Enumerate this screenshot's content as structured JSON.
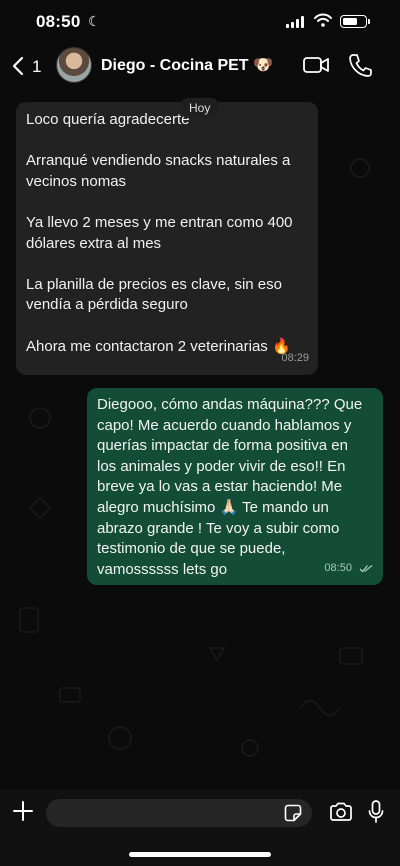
{
  "status_bar": {
    "time": "08:50",
    "focus_icon": "moon-icon"
  },
  "header": {
    "back_count": "1",
    "contact_name": "Diego - Cocina PET 🐶",
    "avatar": "contact-avatar-photo"
  },
  "chat": {
    "date_chip": "Hoy",
    "incoming": {
      "paragraphs": [
        "Loco quería agradecerte",
        "Arranqué vendiendo snacks naturales a vecinos nomas",
        "Ya llevo 2 meses y me entran como 400 dólares extra al mes",
        "La planilla de precios es clave, sin eso vendía a pérdida seguro",
        "Ahora me contactaron 2 veterinarias 🔥"
      ],
      "time": "08:29"
    },
    "outgoing": {
      "text": "Diegooo, cómo andas máquina??? Que capo! Me acuerdo cuando hablamos y querías impactar de forma positiva en los animales y poder vivir de eso!! En breve ya lo vas a estar haciendo! Me alegro muchísimo 🙏🏻 Te mando un abrazo grande ! Te voy a subir como testimonio de que se puede, vamossssss lets go",
      "time": "08:50",
      "status": "read"
    }
  },
  "composer": {
    "value": "",
    "placeholder": ""
  },
  "colors": {
    "incoming_bubble": "#222222",
    "outgoing_bubble": "#134d37",
    "background": "#0b0b0b"
  }
}
